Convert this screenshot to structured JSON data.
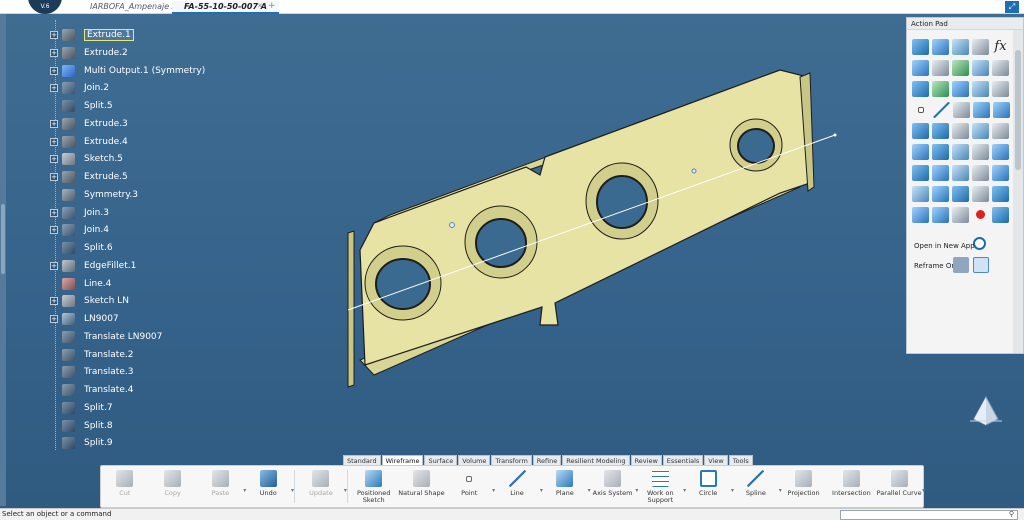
{
  "app": {
    "logo_text": "V.6"
  },
  "tabs": [
    {
      "label": "IARBOFA_Ampenaje A"
    },
    {
      "label": "FA-55-10-50-007 A"
    }
  ],
  "tab_add": "+",
  "tree": [
    {
      "label": "Extrude.1",
      "icon": "extrude-icon",
      "expandable": true,
      "selected": true
    },
    {
      "label": "Extrude.2",
      "icon": "extrude-icon",
      "expandable": true
    },
    {
      "label": "Multi Output.1 (Symmetry)",
      "icon": "multi-output-icon",
      "expandable": true
    },
    {
      "label": "Join.2",
      "icon": "join-icon",
      "expandable": true
    },
    {
      "label": "Split.5",
      "icon": "split-icon",
      "expandable": false
    },
    {
      "label": "Extrude.3",
      "icon": "extrude-icon",
      "expandable": true
    },
    {
      "label": "Extrude.4",
      "icon": "extrude-icon",
      "expandable": true
    },
    {
      "label": "Sketch.5",
      "icon": "sketch-icon",
      "expandable": true
    },
    {
      "label": "Extrude.5",
      "icon": "extrude-icon",
      "expandable": true
    },
    {
      "label": "Symmetry.3",
      "icon": "symmetry-icon",
      "expandable": false
    },
    {
      "label": "Join.3",
      "icon": "join-icon",
      "expandable": true
    },
    {
      "label": "Join.4",
      "icon": "join-icon",
      "expandable": true
    },
    {
      "label": "Split.6",
      "icon": "split-icon",
      "expandable": false
    },
    {
      "label": "EdgeFillet.1",
      "icon": "edge-fillet-icon",
      "expandable": true
    },
    {
      "label": "Line.4",
      "icon": "line-icon",
      "expandable": false
    },
    {
      "label": "Sketch LN",
      "icon": "sketch-icon",
      "expandable": true
    },
    {
      "label": "LN9007",
      "icon": "ln-icon",
      "expandable": true
    },
    {
      "label": "Translate LN9007",
      "icon": "translate-icon",
      "expandable": false
    },
    {
      "label": "Translate.2",
      "icon": "translate-icon",
      "expandable": false
    },
    {
      "label": "Translate.3",
      "icon": "translate-icon",
      "expandable": false
    },
    {
      "label": "Translate.4",
      "icon": "translate-icon",
      "expandable": false
    },
    {
      "label": "Split.7",
      "icon": "split-icon",
      "expandable": false
    },
    {
      "label": "Split.8",
      "icon": "split-icon",
      "expandable": false
    },
    {
      "label": "Split.9",
      "icon": "split-icon",
      "expandable": false
    }
  ],
  "action_pad": {
    "title": "Action Pad",
    "fx_label": "fx",
    "open_in_new_app": "Open in New App",
    "reframe_on": "Reframe On"
  },
  "section_tabs": [
    "Standard",
    "Wireframe",
    "Surface",
    "Volume",
    "Transform",
    "Refine",
    "Resilient Modeling",
    "Review",
    "Essentials",
    "View",
    "Tools"
  ],
  "active_section_tab": "Wireframe",
  "toolbar": [
    {
      "label": "Cut",
      "icon": "scissors-icon",
      "disabled": true
    },
    {
      "label": "Copy",
      "icon": "copy-icon",
      "disabled": true
    },
    {
      "label": "Paste",
      "icon": "paste-icon",
      "disabled": true,
      "dropdown": true
    },
    {
      "label": "Undo",
      "icon": "undo-icon",
      "disabled": false,
      "dropdown": true
    },
    {
      "label": "Update",
      "icon": "update-icon",
      "disabled": true,
      "dropdown": true
    },
    {
      "label": "Positioned Sketch",
      "icon": "positioned-sketch-icon",
      "disabled": false
    },
    {
      "label": "Natural Shape",
      "icon": "natural-shape-icon",
      "disabled": false
    },
    {
      "label": "Point",
      "icon": "point-icon",
      "disabled": false,
      "dropdown": true
    },
    {
      "label": "Line",
      "icon": "line-icon",
      "disabled": false,
      "dropdown": true
    },
    {
      "label": "Plane",
      "icon": "plane-icon",
      "disabled": false,
      "dropdown": true
    },
    {
      "label": "Axis System",
      "icon": "axis-system-icon",
      "disabled": false,
      "dropdown": true
    },
    {
      "label": "Work on Support",
      "icon": "grid-icon",
      "disabled": false,
      "dropdown": true
    },
    {
      "label": "Circle",
      "icon": "circle-icon",
      "disabled": false,
      "dropdown": true
    },
    {
      "label": "Spline",
      "icon": "spline-icon",
      "disabled": false,
      "dropdown": true
    },
    {
      "label": "Projection",
      "icon": "projection-icon",
      "disabled": false
    },
    {
      "label": "Intersection",
      "icon": "intersection-icon",
      "disabled": false
    },
    {
      "label": "Parallel Curve",
      "icon": "parallel-curve-icon",
      "disabled": false,
      "dropdown": true
    }
  ],
  "status": {
    "message": "Select an object or a command"
  },
  "colors": {
    "viewport_bg": "#3a6a90",
    "part_fill": "#e6e3a4",
    "part_edge": "#1d1d1d",
    "accent": "#1f6fb0"
  }
}
